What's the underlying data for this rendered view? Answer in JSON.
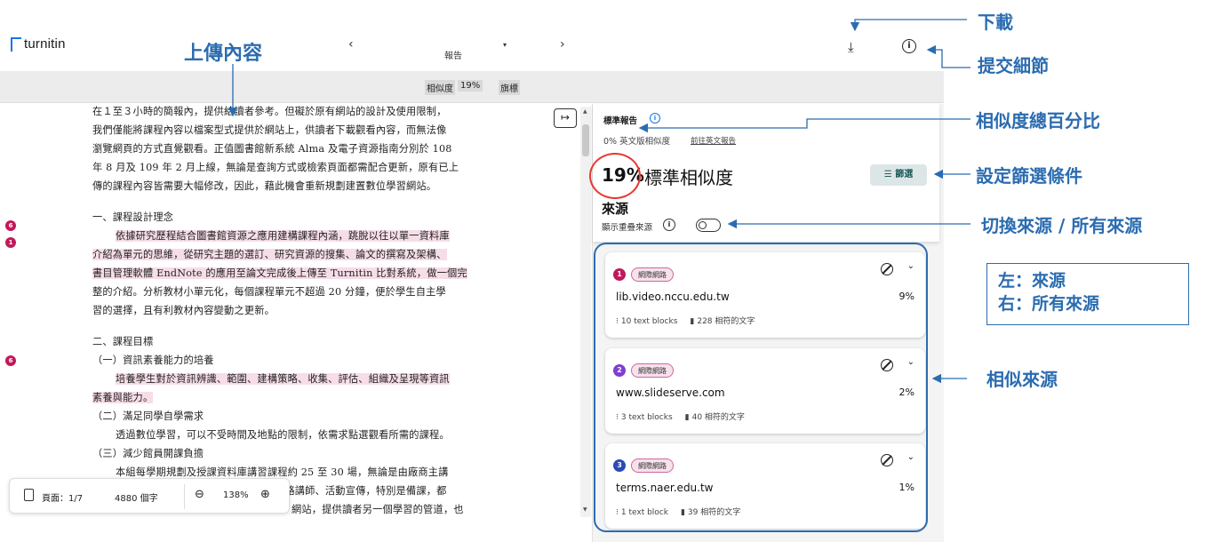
{
  "app": {
    "logo_text": "turnitin"
  },
  "header": {
    "prev": "‹",
    "next": "›",
    "report_label": "報告",
    "report_caret": "▾",
    "download_icon": "download-icon",
    "info_icon": "info-icon"
  },
  "subbar": {
    "similarity_label": "相似度",
    "similarity_pct": "19%",
    "flags_label": "旗標"
  },
  "document": {
    "lines": [
      "在１至３小時的簡報內，提供給讀者參考。但礙於原有網站的設計及使用限制，",
      "我們僅能將課程內容以檔案型式提供於網站上，供讀者下載觀看內容，而無法像",
      "瀏覽網頁的方式直覺觀看。正值圖書館新系統 Alma 及電子資源指南分別於 108",
      "年 8 月及 109 年 2 月上線，無論是查詢方式或檢索頁面都需配合更新，原有已上",
      "傳的課程內容皆需要大幅修改，因此，藉此機會重新規劃建置數位學習網站。",
      "一、課程設計理念",
      "依據研究歷程結合圖書館資源之應用建構課程內涵，跳脫以往以單一資料庫",
      "介紹為單元的思維，從研究主題的選訂、研究資源的搜集、論文的撰寫及架構、",
      "書目管理軟體 EndNote 的應用至論文完成後上傳至 Turnitin 比對系統，做一個完",
      "整的介紹。分析教材小單元化，每個課程單元不超過 20 分鐘，便於學生自主學",
      "習的選擇，且有利教材內容變動之更新。",
      "二、課程目標",
      "（一）資訊素養能力的培養",
      "培養學生對於資訊辨識、範圍、建構策略、收集、評估、組織及呈現等資訊",
      "素養與能力。",
      "（二）滿足同學自學需求",
      "透過數位學習，可以不受時間及地點的限制，依需求點選觀看所需的課程。",
      "（三）減少館員開課負擔",
      "本組每學期規劃及授課資料庫講習課程約 25 至 30 場，無論是由廠商主講",
      "或是館員授課，從課程規劃、場地安排、聯絡講師、活動宣傳，特別是備課，都",
      "網站，提供讀者另一個學習的管道，也"
    ],
    "markers": [
      "6",
      "1",
      "6"
    ],
    "footer": {
      "page_label": "頁面：1/7",
      "word_count": "4880 個字",
      "zoom": "138%",
      "zoom_out_icon": "zoom-out-icon",
      "zoom_in_icon": "zoom-in-icon"
    }
  },
  "panel": {
    "std_report": "標準報告",
    "english_sim": "0% 英文版相似度",
    "english_link": "前往英文報告",
    "pct_big": "19%",
    "std_sim_label": "標準相似度",
    "filter_label": "篩選",
    "sources_title": "來源",
    "overlap_label": "顯示重疊來源",
    "sources": [
      {
        "num": "1",
        "tag": "網際網路",
        "url": "lib.video.nccu.edu.tw",
        "pct": "9%",
        "blocks": "10 text blocks",
        "words": "228 相符的文字",
        "color": "#c2185b"
      },
      {
        "num": "2",
        "tag": "網際網路",
        "url": "www.slideserve.com",
        "pct": "2%",
        "blocks": "3 text blocks",
        "words": "40 相符的文字",
        "color": "#7e3fd1"
      },
      {
        "num": "3",
        "tag": "網際網路",
        "url": "terms.naer.edu.tw",
        "pct": "1%",
        "blocks": "1 text block",
        "words": "39 相符的文字",
        "color": "#2d49b8"
      }
    ]
  },
  "annotations": {
    "upload": "上傳內容",
    "download": "下載",
    "details": "提交細節",
    "total_pct": "相似度總百分比",
    "filter": "設定篩選條件",
    "toggle": "切換來源 / 所有來源",
    "box_line1": "左：來源",
    "box_line2": "右：所有來源",
    "similar_sources": "相似來源"
  },
  "colors": {
    "accent": "#2b6cb0",
    "highlight": "#f6dde8",
    "circle": "#e53935"
  }
}
